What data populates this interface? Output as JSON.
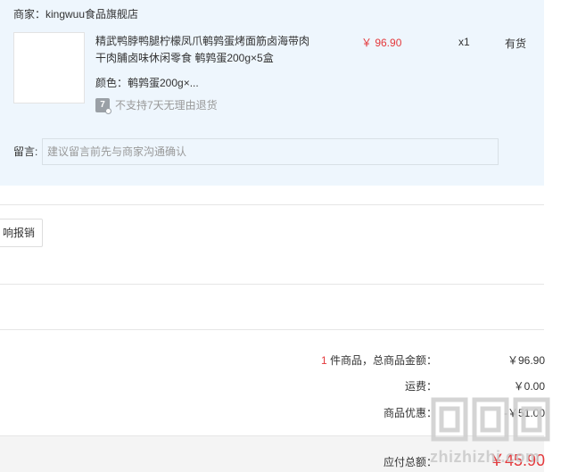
{
  "order": {
    "merchant_label": "商家：kingwuu食品旗舰店",
    "product": {
      "title": "精武鸭脖鸭腿柠檬凤爪鹌鹑蛋烤面筋卤海带肉干肉脯卤味休闲零食 鹌鹑蛋200g×5盒",
      "spec": "颜色：鹌鹑蛋200g×...",
      "return_badge": "7",
      "return_policy": "不支持7天无理由退货",
      "unit_price": "￥ 96.90",
      "quantity": "x1",
      "stock_status": "有货"
    },
    "note": {
      "label": "留言:",
      "placeholder": "建议留言前先与商家沟通确认",
      "value": ""
    }
  },
  "reimburse_button_label": "响报销",
  "summary": {
    "item_count": "1",
    "subtotal_label_suffix": " 件商品，总商品金额：",
    "subtotal_value": "￥96.90",
    "shipping_label": "运费：",
    "shipping_value": "￥0.00",
    "discount_label": "商品优惠：",
    "discount_value": "-￥51.00",
    "total_label": "应付总额：",
    "total_value": "￥45.90"
  },
  "colors": {
    "accent_red": "#e4393c",
    "card_background": "#eef6fd"
  },
  "watermark": {
    "text": "zhizhizhi.com"
  }
}
